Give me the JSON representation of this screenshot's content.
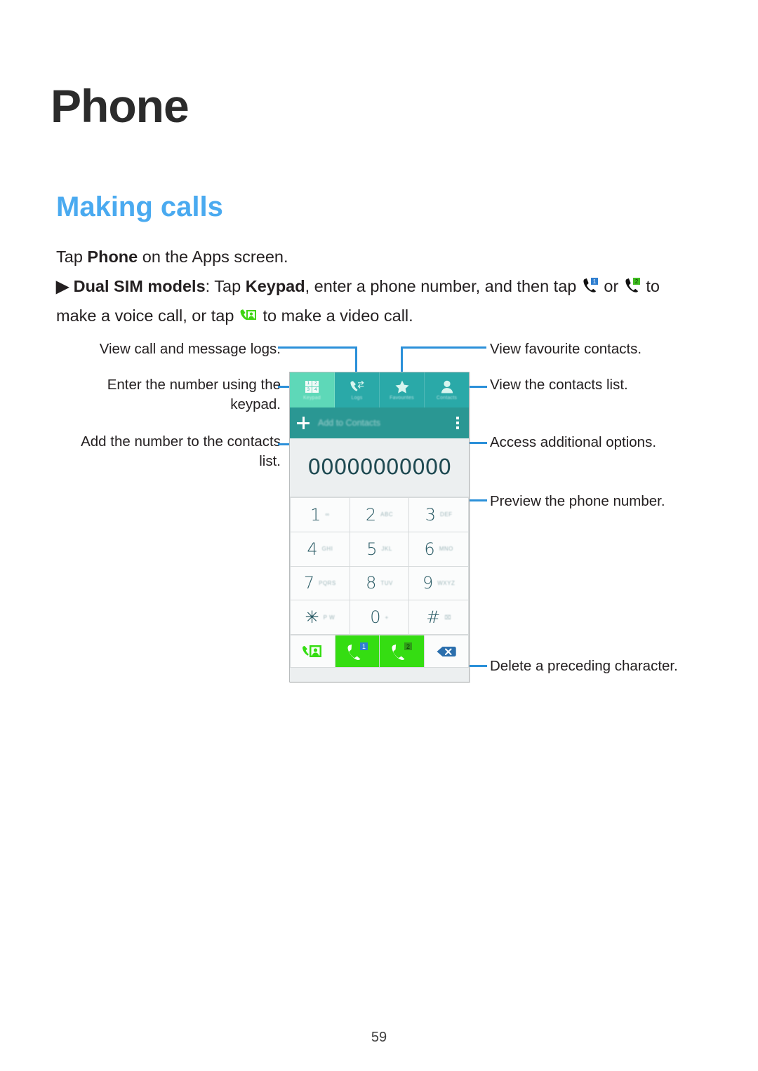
{
  "page": {
    "title": "Phone",
    "section_title": "Making calls",
    "number": "59",
    "accent_color": "#4aaaf0",
    "leader_color": "#2b90d9"
  },
  "body": {
    "para1_pre": "Tap ",
    "para1_bold": "Phone",
    "para1_post": " on the Apps screen.",
    "para2_arrow": "▶",
    "para2_bold1": " Dual SIM models",
    "para2_t1": ": Tap ",
    "para2_bold2": "Keypad",
    "para2_t2": ", enter a phone number, and then tap ",
    "para2_t3": " or ",
    "para2_t4": " to make a voice call, or tap ",
    "para2_t5": " to make a video call.",
    "icon_call_sim1": "call-sim1-icon",
    "icon_call_sim2": "call-sim2-icon",
    "icon_video_call": "video-call-icon"
  },
  "callouts": {
    "left": [
      {
        "text": "View call and message logs.",
        "name": "callout-view-logs"
      },
      {
        "text": "Enter the number using the\nkeypad.",
        "name": "callout-enter-number"
      },
      {
        "text": "Add the number to the contacts\nlist.",
        "name": "callout-add-contact"
      }
    ],
    "right": [
      {
        "text": "View favourite contacts.",
        "name": "callout-view-favourites"
      },
      {
        "text": "View the contacts list.",
        "name": "callout-view-contacts"
      },
      {
        "text": "Access additional options.",
        "name": "callout-more-options"
      },
      {
        "text": "Preview the phone number.",
        "name": "callout-preview-number"
      },
      {
        "text": "Delete a preceding character.",
        "name": "callout-delete-character"
      }
    ]
  },
  "phone": {
    "tabs": [
      {
        "label": "Keypad",
        "icon": "keypad-grid-icon",
        "selected": true
      },
      {
        "label": "Logs",
        "icon": "call-logs-icon",
        "selected": false
      },
      {
        "label": "Favourites",
        "icon": "star-icon",
        "selected": false
      },
      {
        "label": "Contacts",
        "icon": "person-icon",
        "selected": false
      }
    ],
    "action_bar": {
      "add_label": "Add to Contacts",
      "plus_icon": "plus-icon",
      "more_icon": "more-vertical-icon"
    },
    "number_display": "00000000000",
    "keys": [
      {
        "digit": "1",
        "sub": "∞"
      },
      {
        "digit": "2",
        "sub": "ABC"
      },
      {
        "digit": "3",
        "sub": "DEF"
      },
      {
        "digit": "4",
        "sub": "GHI"
      },
      {
        "digit": "5",
        "sub": "JKL"
      },
      {
        "digit": "6",
        "sub": "MNO"
      },
      {
        "digit": "7",
        "sub": "PQRS"
      },
      {
        "digit": "8",
        "sub": "TUV"
      },
      {
        "digit": "9",
        "sub": "WXYZ"
      },
      {
        "digit": "✳",
        "sub": "P W"
      },
      {
        "digit": "0",
        "sub": "+"
      },
      {
        "digit": "#",
        "sub": "⌧"
      }
    ],
    "bottom_buttons": [
      {
        "name": "video-call-button",
        "icon": "video-call-icon",
        "badge": ""
      },
      {
        "name": "call-sim1-button",
        "icon": "call-icon",
        "badge": "1"
      },
      {
        "name": "call-sim2-button",
        "icon": "call-icon",
        "badge": "2"
      },
      {
        "name": "backspace-button",
        "icon": "backspace-icon",
        "badge": ""
      }
    ],
    "colors": {
      "tab_bar": "#2aa9a8",
      "tab_selected": "#5ed8b8",
      "action_bar": "#2a9793",
      "call_button": "#35dd12",
      "number_text": "#1f4a52"
    }
  }
}
